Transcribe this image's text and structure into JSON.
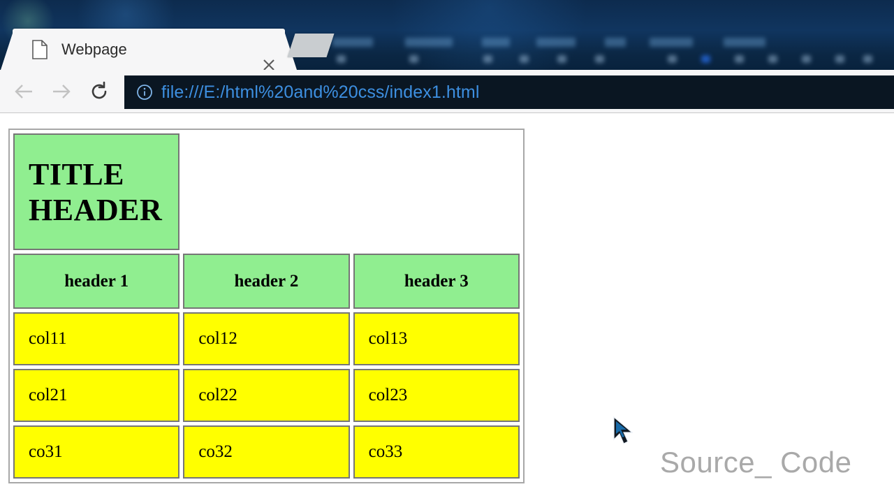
{
  "browser": {
    "tab": {
      "title": "Webpage",
      "favicon_icon": "page-icon",
      "close_icon": "close-icon"
    },
    "new_tab_label": "",
    "nav": {
      "back_icon": "arrow-left-icon",
      "forward_icon": "arrow-right-icon",
      "reload_icon": "reload-icon"
    },
    "omnibox": {
      "info_icon": "info-circle-icon",
      "url": "file:///E:/html%20and%20css/index1.html"
    }
  },
  "page": {
    "table": {
      "title_cell": "TITLE HEADER",
      "headers": [
        "header 1",
        "header 2",
        "header 3"
      ],
      "rows": [
        [
          "col11",
          "col12",
          "col13"
        ],
        [
          "col21",
          "col22",
          "col23"
        ],
        [
          "co31",
          "co32",
          "co33"
        ]
      ]
    },
    "watermark": "Source_ Code"
  },
  "colors": {
    "header_green": "#90ee90",
    "data_yellow": "#ffff00",
    "cell_border": "#767676",
    "table_border": "#a8a8a8",
    "omnibox_bg": "#0a1622",
    "url_text": "#3d8fe0",
    "watermark_text": "#a9a9a9"
  }
}
